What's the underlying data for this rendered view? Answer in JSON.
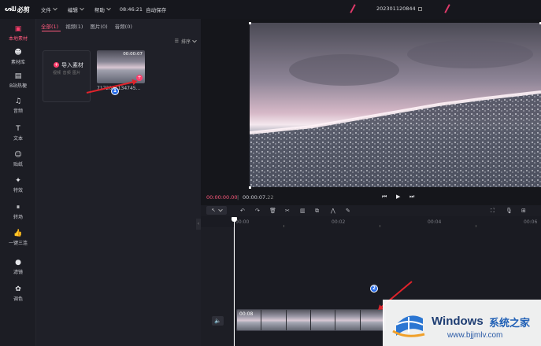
{
  "app": {
    "logo_text": "必剪",
    "menu": [
      {
        "label": "文件"
      },
      {
        "label": "编辑"
      },
      {
        "label": "帮助"
      }
    ],
    "clock": "08:46:21",
    "autosave": "自动保存",
    "project_name": "202301120844"
  },
  "rail": {
    "items": [
      {
        "label": "本地素材",
        "icon": "folder-icon",
        "active": true
      },
      {
        "label": "素材库",
        "icon": "library-icon"
      },
      {
        "label": "B站热梗",
        "icon": "bilibili-icon"
      },
      {
        "label": "音频",
        "icon": "music-icon"
      },
      {
        "label": "文本",
        "icon": "text-icon"
      },
      {
        "label": "贴纸",
        "icon": "sticker-icon"
      },
      {
        "label": "特效",
        "icon": "effect-icon"
      },
      {
        "label": "转场",
        "icon": "transition-icon"
      },
      {
        "label": "一键三连",
        "icon": "thumbs-up-icon"
      },
      {
        "label": "滤镜",
        "icon": "filter-icon"
      },
      {
        "label": "调色",
        "icon": "palette-icon"
      }
    ]
  },
  "media": {
    "tabs": [
      {
        "label": "全部(1)"
      },
      {
        "label": "视频(1)"
      },
      {
        "label": "图片(0)"
      },
      {
        "label": "音频(0)"
      }
    ],
    "sort_label": "排序",
    "import_label": "导入素材",
    "import_sub": "视频 音频 图片",
    "thumb_duration": "00:00:07",
    "thumb_name": "7172051134745..."
  },
  "annotations": {
    "badge1": "1",
    "badge2": "2"
  },
  "preview": {
    "time_current": "00:00:00",
    "time_current_frames": "00",
    "time_total": "00:00:07",
    "time_total_frames": "22"
  },
  "timeline": {
    "ticks": [
      "00:00",
      "00:02",
      "00:04",
      "00:06"
    ],
    "clip_duration": "00:08"
  },
  "watermark": {
    "title": "Windows",
    "cn": "系统之家",
    "url": "www.bjjmlv.com"
  }
}
